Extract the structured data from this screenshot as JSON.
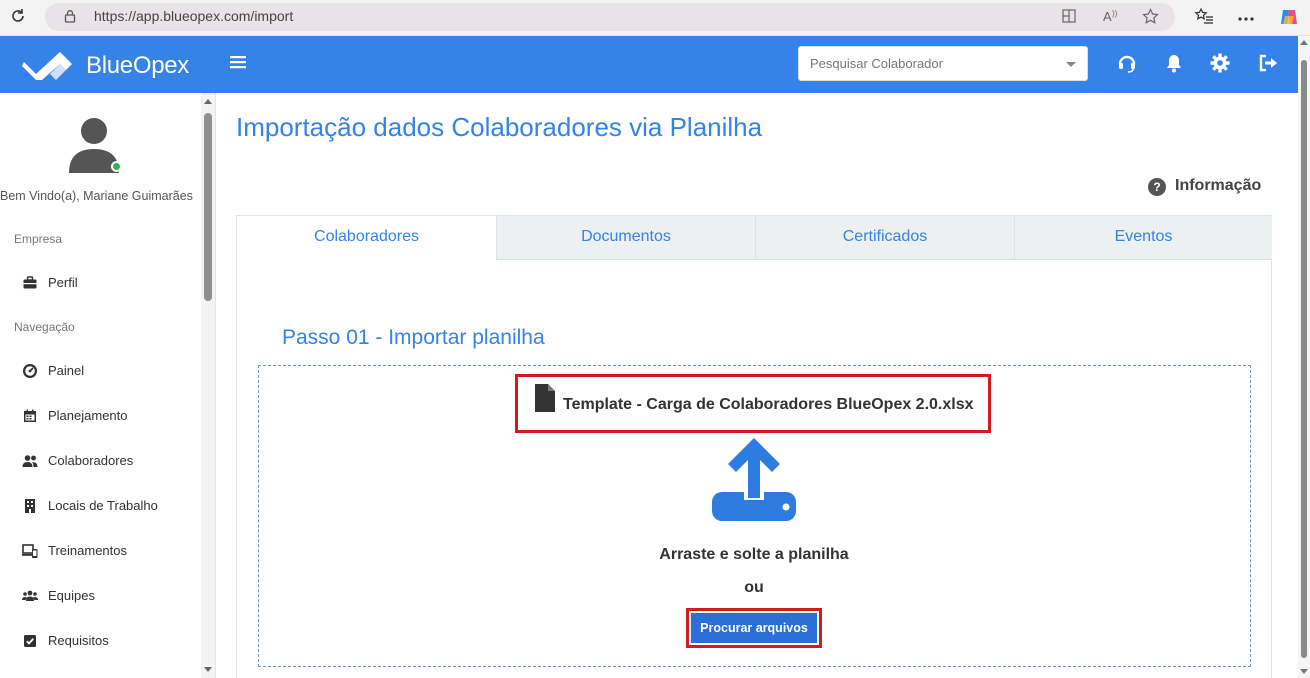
{
  "browser": {
    "url": "https://app.blueopex.com/import"
  },
  "header": {
    "brand": "BlueOpex",
    "search_placeholder": "Pesquisar Colaborador",
    "accent": "#3582e8"
  },
  "sidebar": {
    "welcome": "Bem Vindo(a), Mariane Guimarães",
    "section_company": "Empresa",
    "section_nav": "Navegação",
    "company_items": [
      {
        "label": "Perfil",
        "icon": "briefcase-icon"
      }
    ],
    "nav_items": [
      {
        "label": "Painel",
        "icon": "dashboard-icon"
      },
      {
        "label": "Planejamento",
        "icon": "calendar-icon"
      },
      {
        "label": "Colaboradores",
        "icon": "users-icon"
      },
      {
        "label": "Locais de Trabalho",
        "icon": "building-icon"
      },
      {
        "label": "Treinamentos",
        "icon": "devices-icon"
      },
      {
        "label": "Equipes",
        "icon": "team-icon"
      },
      {
        "label": "Requisitos",
        "icon": "checkbox-icon"
      }
    ]
  },
  "main": {
    "title": "Importação dados Colaboradores via Planilha",
    "info_label": "Informação",
    "tabs": [
      {
        "label": "Colaboradores",
        "active": true
      },
      {
        "label": "Documentos",
        "active": false
      },
      {
        "label": "Certificados",
        "active": false
      },
      {
        "label": "Eventos",
        "active": false
      }
    ],
    "step_title": "Passo 01 - Importar planilha",
    "template_file": "Template - Carga de Colaboradores BlueOpex 2.0.xlsx",
    "drag_text": "Arraste e solte a planilha",
    "or_text": "ou",
    "browse_button": "Procurar arquivos"
  },
  "colors": {
    "primary": "#3582e8",
    "highlight": "#d4191f",
    "button": "#2b6fd6",
    "online": "#2eb84b"
  }
}
